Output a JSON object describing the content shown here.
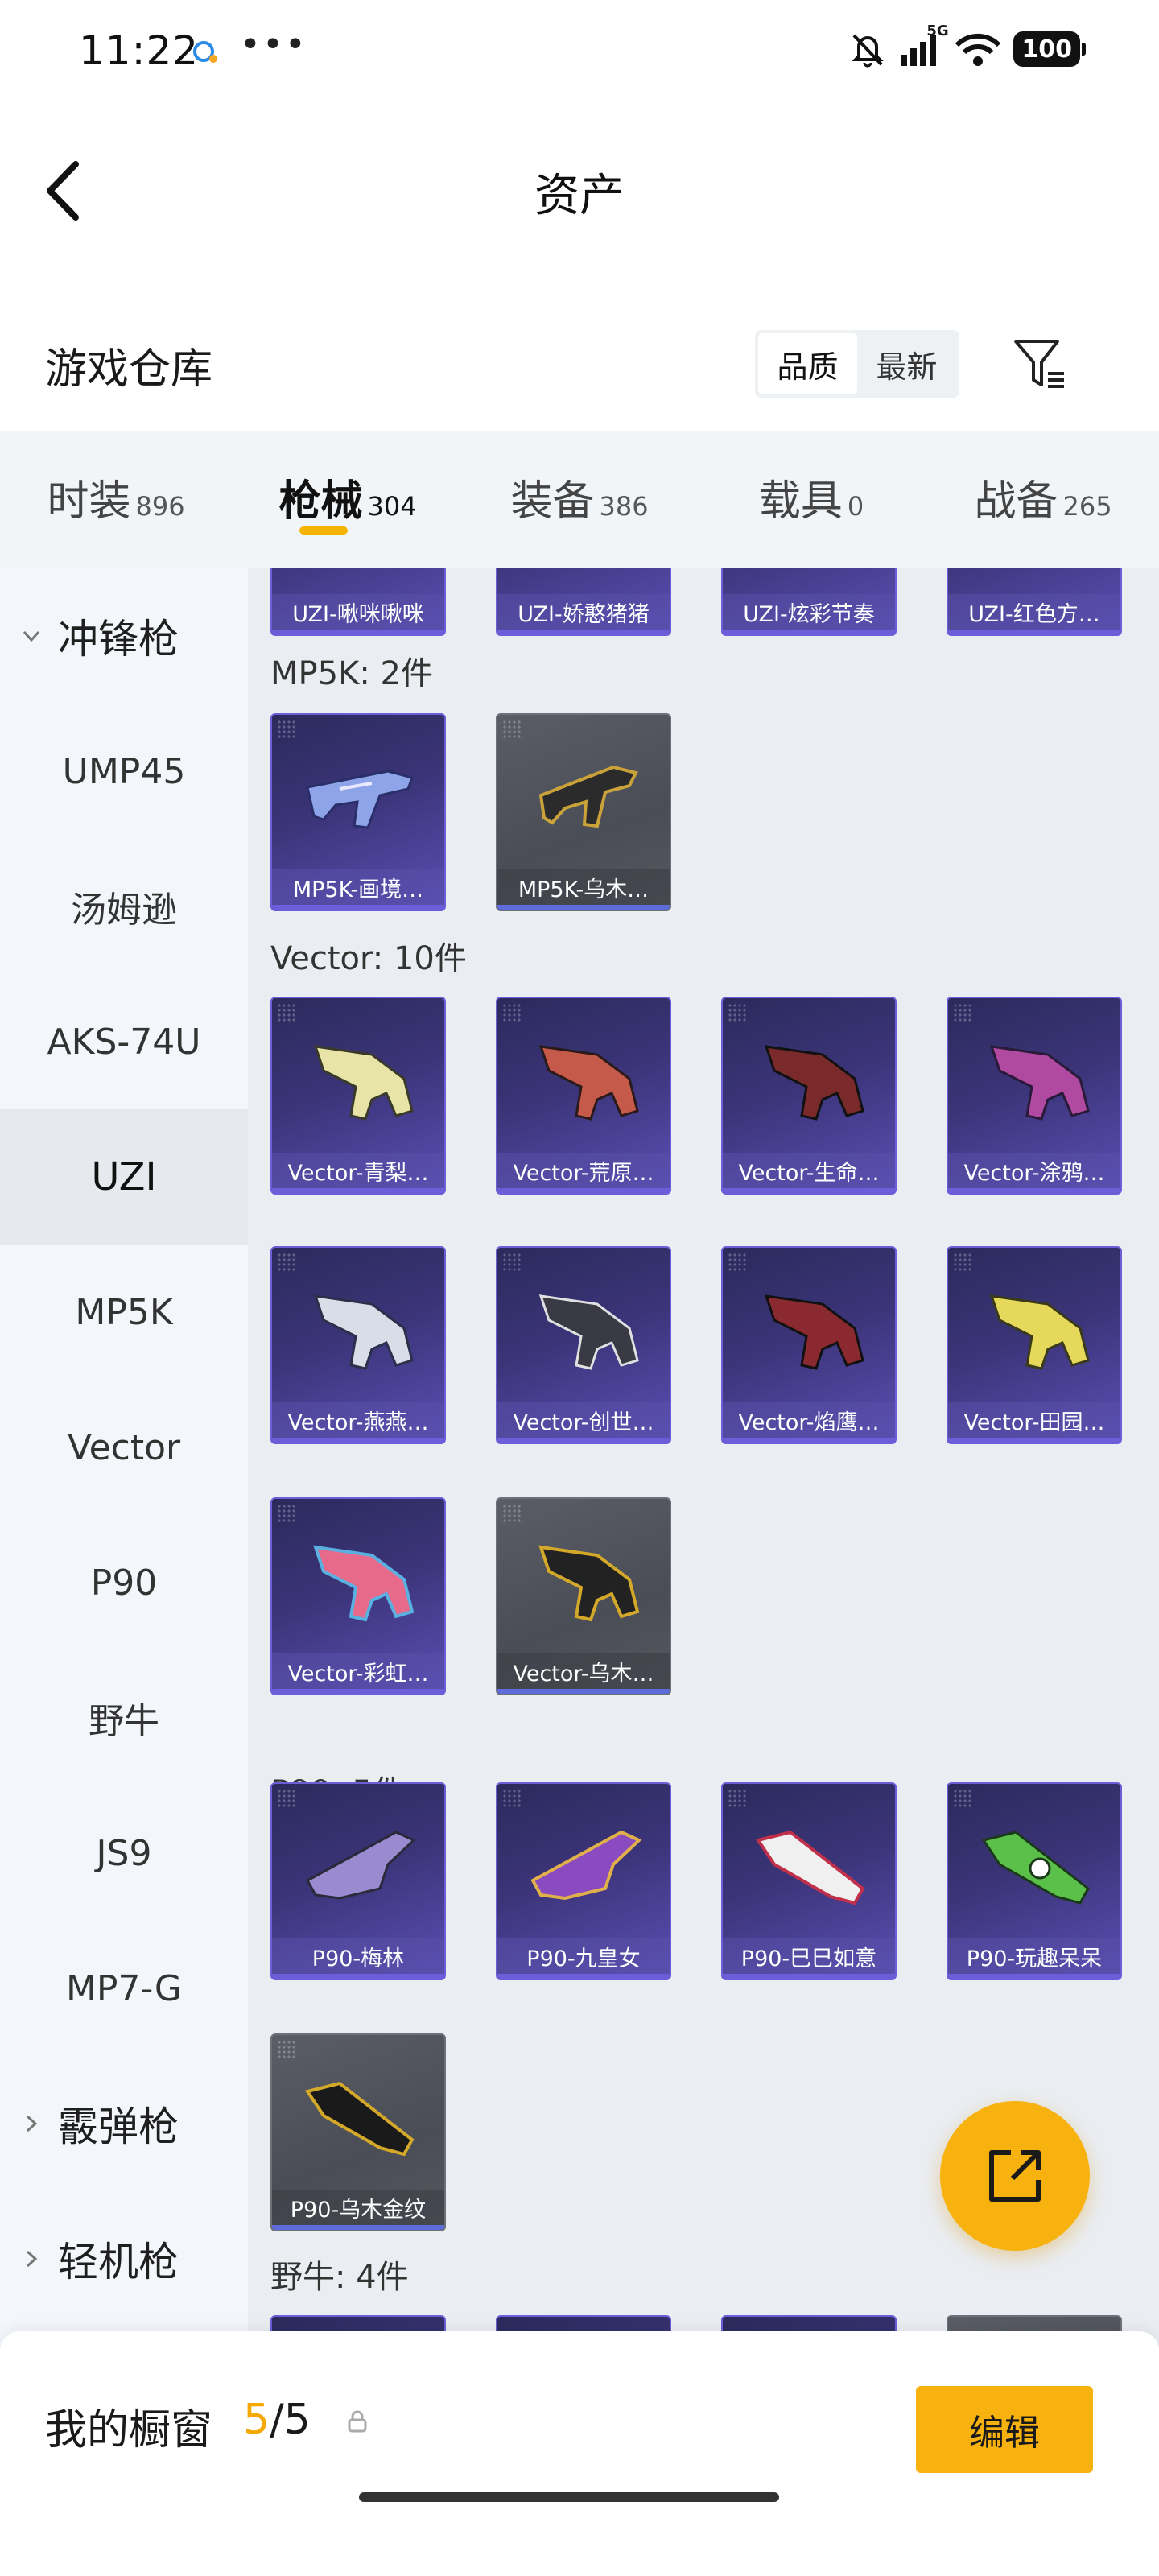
{
  "status_bar": {
    "time": "11:22",
    "more": "•••",
    "network": "5G",
    "battery": "100"
  },
  "header": {
    "title": "资产"
  },
  "warehouse": {
    "title": "游戏仓库",
    "sort_quality": "品质",
    "sort_newest": "最新"
  },
  "tabs": [
    {
      "label": "时装",
      "count": "896"
    },
    {
      "label": "枪械",
      "count": "304"
    },
    {
      "label": "装备",
      "count": "386"
    },
    {
      "label": "载具",
      "count": "0"
    },
    {
      "label": "战备",
      "count": "265"
    }
  ],
  "sidebar": {
    "group_smg": "冲锋枪",
    "items": [
      "UMP45",
      "汤姆逊",
      "AKS-74U",
      "UZI",
      "MP5K",
      "Vector",
      "P90",
      "野牛",
      "JS9",
      "MP7-G"
    ],
    "group_shotgun": "霰弹枪",
    "group_lmg": "轻机枪"
  },
  "sections": {
    "uzi": [
      "UZI-啾咪啾咪",
      "UZI-娇憨猪猪",
      "UZI-炫彩节奏",
      "UZI-红色方…"
    ],
    "mp5k_label": "MP5K: 2件",
    "mp5k": [
      "MP5K-画境…",
      "MP5K-乌木…"
    ],
    "vector_label": "Vector: 10件",
    "vector": [
      "Vector-青梨…",
      "Vector-荒原…",
      "Vector-生命…",
      "Vector-涂鸦…",
      "Vector-燕燕…",
      "Vector-创世…",
      "Vector-焰鹰…",
      "Vector-田园…",
      "Vector-彩虹…",
      "Vector-乌木…"
    ],
    "p90_label": "P90: 5件",
    "p90": [
      "P90-梅林",
      "P90-九皇女",
      "P90-巳巳如意",
      "P90-玩趣呆呆",
      "P90-乌木金纹"
    ],
    "bison_label": "野牛: 4件"
  },
  "colors": {
    "accent": "#f7b20f",
    "rare_purple": "#6c5dd9",
    "tab_bg": "#f2f5f8",
    "grid_bg": "#eaedf2"
  },
  "bottom_bar": {
    "title": "我的橱窗",
    "count_current": "5",
    "count_total": "/5",
    "edit_label": "编辑"
  }
}
